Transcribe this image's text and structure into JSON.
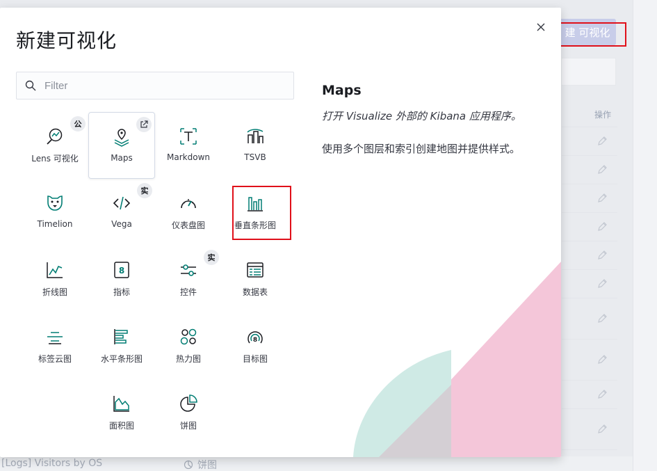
{
  "background": {
    "create_button_label": "建 可视化",
    "operations_header": "操作",
    "bottom_row": {
      "name": "[Logs] Visitors by OS",
      "type": "饼图"
    }
  },
  "modal": {
    "title": "新建可视化",
    "filter_placeholder": "Filter",
    "tiles": [
      {
        "label": "Lens 可视化",
        "icon": "lens-icon",
        "badge": "公"
      },
      {
        "label": "Maps",
        "icon": "maps-icon",
        "badge": "external-link-icon",
        "selected": true
      },
      {
        "label": "Markdown",
        "icon": "markdown-icon"
      },
      {
        "label": "TSVB",
        "icon": "tsvb-icon"
      },
      {
        "label": "Timelion",
        "icon": "timelion-icon"
      },
      {
        "label": "Vega",
        "icon": "vega-icon",
        "badge": "实"
      },
      {
        "label": "仪表盘图",
        "icon": "gauge-icon"
      },
      {
        "label": "垂直条形图",
        "icon": "vertical-bar-icon"
      },
      {
        "label": "折线图",
        "icon": "line-chart-icon"
      },
      {
        "label": "指标",
        "icon": "metric-icon"
      },
      {
        "label": "控件",
        "icon": "controls-icon",
        "badge": "实"
      },
      {
        "label": "数据表",
        "icon": "data-table-icon"
      },
      {
        "label": "标签云图",
        "icon": "tag-cloud-icon"
      },
      {
        "label": "水平条形图",
        "icon": "horizontal-bar-icon"
      },
      {
        "label": "热力图",
        "icon": "heatmap-icon"
      },
      {
        "label": "目标图",
        "icon": "goal-icon"
      },
      {
        "label": "面积图",
        "icon": "area-chart-icon"
      },
      {
        "label": "饼图",
        "icon": "pie-chart-icon"
      }
    ],
    "description": {
      "title": "Maps",
      "subtitle": "打开 Visualize 外部的 Kibana 应用程序。",
      "body": "使用多个图层和索引创建地图并提供样式。"
    }
  },
  "colors": {
    "accent_teal": "#017d73",
    "highlight_red": "#e0101a",
    "deco_pink": "#f4c6d9",
    "deco_mint": "#cfeae5"
  }
}
